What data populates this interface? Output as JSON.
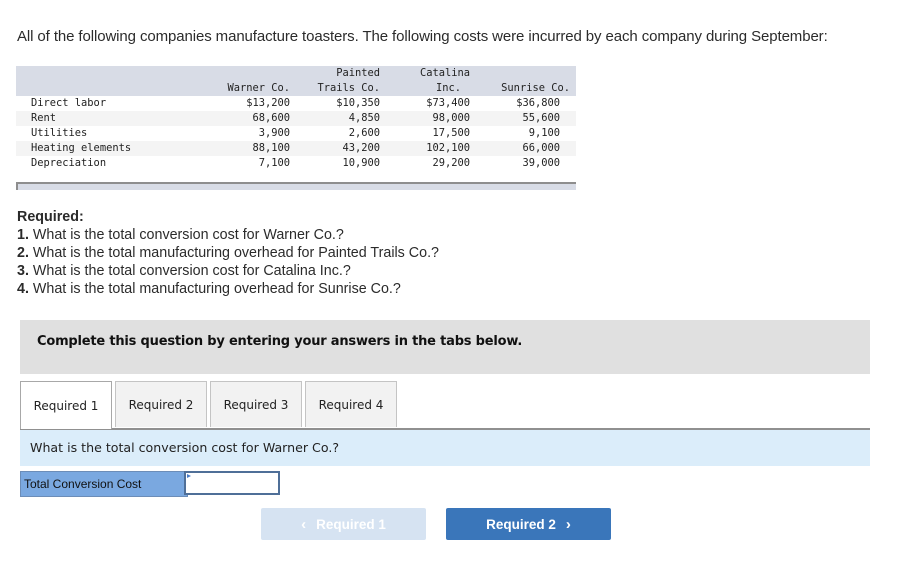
{
  "intro": "All of the following companies manufacture toasters. The following costs were incurred by each company during September:",
  "cost_table": {
    "columns": [
      {
        "line1": "",
        "line2": "Warner Co."
      },
      {
        "line1": "Painted",
        "line2": "Trails Co."
      },
      {
        "line1": "Catalina",
        "line2": "Inc."
      },
      {
        "line1": "",
        "line2": "Sunrise Co."
      }
    ],
    "rows": [
      {
        "label": "Direct labor",
        "values": [
          "$13,200",
          "$10,350",
          "$73,400",
          "$36,800"
        ]
      },
      {
        "label": "Rent",
        "values": [
          "68,600",
          "4,850",
          "98,000",
          "55,600"
        ]
      },
      {
        "label": "Utilities",
        "values": [
          "3,900",
          "2,600",
          "17,500",
          "9,100"
        ]
      },
      {
        "label": "Heating elements",
        "values": [
          "88,100",
          "43,200",
          "102,100",
          "66,000"
        ]
      },
      {
        "label": "Depreciation",
        "values": [
          "7,100",
          "10,900",
          "29,200",
          "39,000"
        ]
      }
    ]
  },
  "required": {
    "title": "Required:",
    "items": [
      {
        "num": "1.",
        "text": " What is the total conversion cost for Warner Co.?"
      },
      {
        "num": "2.",
        "text": " What is the total manufacturing overhead for Painted Trails Co.?"
      },
      {
        "num": "3.",
        "text": " What is the total conversion cost for Catalina Inc.?"
      },
      {
        "num": "4.",
        "text": " What is the total manufacturing overhead for Sunrise Co.?"
      }
    ]
  },
  "instruction": "Complete this question by entering your answers in the tabs below.",
  "tabs": [
    {
      "label": "Required 1",
      "active": true
    },
    {
      "label": "Required 2",
      "active": false
    },
    {
      "label": "Required 3",
      "active": false
    },
    {
      "label": "Required 4",
      "active": false
    }
  ],
  "question": "What is the total conversion cost for Warner Co.?",
  "answer": {
    "label": "Total Conversion Cost",
    "value": ""
  },
  "nav": {
    "prev_label": "Required 1",
    "prev_icon": "chevron-left-icon",
    "next_label": "Required 2",
    "next_icon": "chevron-right-icon",
    "prev_enabled": false
  },
  "colors": {
    "table_header": "#d8dce6",
    "instruction_band": "#e0e0e0",
    "question_band": "#dbedfa",
    "answer_label": "#7aa8e0",
    "next_button": "#3a76ba",
    "prev_button_disabled": "#d6e3f2"
  }
}
